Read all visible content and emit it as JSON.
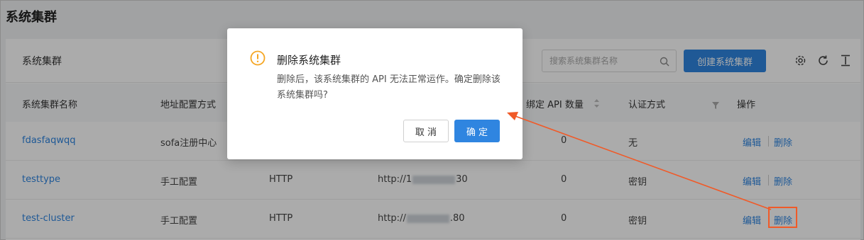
{
  "page_title": "系统集群",
  "card": {
    "title": "系统集群",
    "search_placeholder": "搜索系统集群名称",
    "create_button": "创建系统集群"
  },
  "table": {
    "headers": [
      "系统集群名称",
      "地址配置方式",
      "绑定 API 数量",
      "认证方式",
      "操作"
    ],
    "rows": [
      {
        "name": "fdasfaqwqq",
        "config": "sofa注册中心",
        "protocol": "",
        "address_prefix": "",
        "address_suffix": "",
        "api_count": "0",
        "auth": "无",
        "edit": "编辑",
        "delete": "删除"
      },
      {
        "name": "testtype",
        "config": "手工配置",
        "protocol": "HTTP",
        "address_prefix": "http://1",
        "address_suffix": "30",
        "api_count": "0",
        "auth": "密钥",
        "edit": "编辑",
        "delete": "删除"
      },
      {
        "name": "test-cluster",
        "config": "手工配置",
        "protocol": "HTTP",
        "address_prefix": "http://",
        "address_suffix": ".80",
        "api_count": "0",
        "auth": "密钥",
        "edit": "编辑",
        "delete": "删除"
      }
    ]
  },
  "modal": {
    "title": "删除系统集群",
    "body": "删除后，该系统集群的 API 无法正常运作。确定删除该系统集群吗?",
    "cancel": "取 消",
    "ok": "确 定"
  },
  "colors": {
    "primary": "#2f85e0",
    "warning": "#f5a623",
    "annotation": "#f05a28"
  }
}
